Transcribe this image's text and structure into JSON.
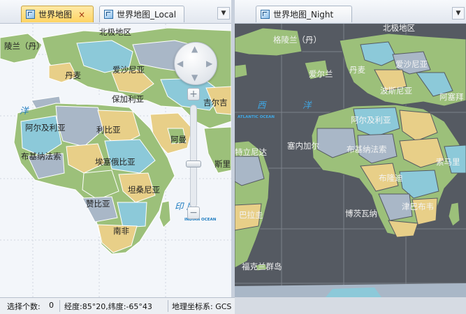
{
  "left_pane": {
    "tab_label": "世界地图",
    "tab_close": "×",
    "tab2_label": "世界地图_Local",
    "menu_arrow": "▼",
    "nav_arrows": {
      "up": "▲",
      "down": "▼",
      "left": "◀",
      "right": "▶"
    },
    "zoom_in": "+",
    "zoom_out": "−",
    "labels": {
      "north_pole": "北极地区",
      "greenland_partial": "陵兰（丹）",
      "denmark": "丹麦",
      "poland": "爱沙尼亚",
      "bulgaria": "保加利亚",
      "kyrgyz_partial": "吉尔吉",
      "algeria": "阿尔及利亚",
      "libya": "利比亚",
      "oman": "阿曼",
      "burkina": "布基纳法索",
      "ethiopia": "埃塞俄比亚",
      "sri_partial": "斯里",
      "tanzania": "坦桑尼亚",
      "zambia": "赞比亚",
      "south_africa": "南非"
    },
    "oceans": {
      "atlantic_partial": "洋",
      "indian": "印   度",
      "indian_en": "INDIAN OCEAN"
    }
  },
  "right_pane": {
    "tab_label": "世界地图_Night",
    "menu_arrow": "▼",
    "labels": {
      "north_pole": "北极地区",
      "greenland": "格陵兰（丹）",
      "iceland": "爱尔兰",
      "denmark": "丹麦",
      "estonia": "爱沙尼亚",
      "bosnia": "波斯尼亚",
      "iran_partial": "阿塞拜",
      "algeria": "阿尔及利亚",
      "trinidad": "特立尼达",
      "senegal": "塞内加尔",
      "burkina": "布基纳法索",
      "somalia_partial": "索马里",
      "burundi": "布隆迪",
      "brazil": "巴拉圭",
      "botswana": "博茨瓦纳",
      "zimbabwe": "津巴布韦",
      "falkland": "福克兰群岛"
    },
    "oceans": {
      "atlantic_west": "西",
      "atlantic_east": "洋",
      "atlantic_en": "ATLANTIC OCEAN"
    }
  },
  "status_bar": {
    "selection_count_label": "选择个数:",
    "selection_count_value": "0",
    "coordinates": "经度:85°20,纬度:-65°43",
    "crs": "地理坐标系: GCS"
  },
  "colors": {
    "land_green": "#9cc07a",
    "land_tan": "#e8cf88",
    "land_blue": "#8cc9d9",
    "land_grey": "#a9b7c7",
    "night_ocean": "#555a62",
    "day_ocean": "#f3f6fa",
    "active_tab": "#ffd463"
  }
}
